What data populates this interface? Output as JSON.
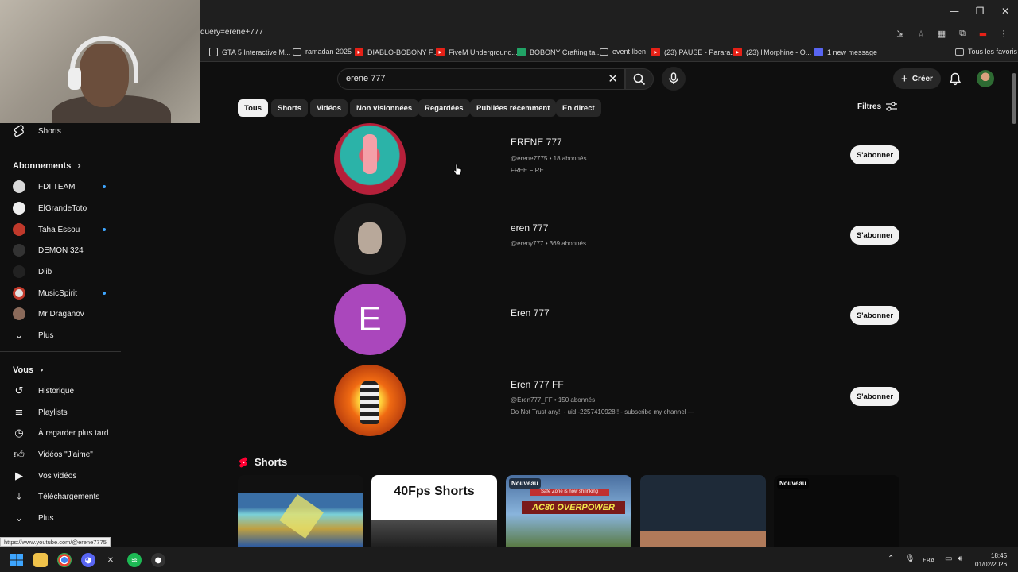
{
  "browser": {
    "url": "query=erene+777",
    "bookmarks": [
      {
        "label": "GTA 5 Interactive M...",
        "icon": "globe-icon"
      },
      {
        "label": "ramadan 2025",
        "icon": "folder-icon"
      },
      {
        "label": "DIABLO-BOBONY F...",
        "icon": "youtube-icon"
      },
      {
        "label": "FiveM Underground...",
        "icon": "youtube-icon"
      },
      {
        "label": "BOBONY Crafting ta...",
        "icon": "sheets-icon"
      },
      {
        "label": "event Iben",
        "icon": "folder-icon"
      },
      {
        "label": "(23) PAUSE - Parara...",
        "icon": "youtube-icon"
      },
      {
        "label": "(23) l'Morphine - O...",
        "icon": "youtube-icon"
      },
      {
        "label": "1 new message",
        "icon": "discord-icon"
      }
    ],
    "all_bookmarks": "Tous les favoris",
    "status_url": "https://www.youtube.com/@erene7775"
  },
  "search": {
    "query": "erene 777"
  },
  "masthead": {
    "create_label": "Créer"
  },
  "chips": [
    "Tous",
    "Shorts",
    "Vidéos",
    "Non visionnées",
    "Regardées",
    "Publiées récemment",
    "En direct"
  ],
  "filters_label": "Filtres",
  "sidebar": {
    "shorts_label": "Shorts",
    "subscriptions_header": "Abonnements",
    "subscriptions": [
      {
        "name": "FDI TEAM",
        "dot": true,
        "color": "#d8d8d8"
      },
      {
        "name": "ElGrandeToto",
        "dot": false,
        "color": "#eeeeee"
      },
      {
        "name": "Taha Essou",
        "dot": true,
        "color": "#c0392b"
      },
      {
        "name": "DEMON 324",
        "dot": false,
        "color": "#333333"
      },
      {
        "name": "Diib",
        "dot": false,
        "color": "#222222"
      },
      {
        "name": "MusicSpirit",
        "dot": true,
        "color": "#e0e0e0"
      },
      {
        "name": "Mr Draganov",
        "dot": false,
        "color": "#8a6a5a"
      }
    ],
    "more_label": "Plus",
    "you_header": "Vous",
    "you_items": [
      {
        "label": "Historique",
        "icon": "history-icon"
      },
      {
        "label": "Playlists",
        "icon": "playlists-icon"
      },
      {
        "label": "À regarder plus tard",
        "icon": "watch-later-icon"
      },
      {
        "label": "Vidéos \"J'aime\"",
        "icon": "like-icon"
      },
      {
        "label": "Vos vidéos",
        "icon": "your-videos-icon"
      },
      {
        "label": "Téléchargements",
        "icon": "downloads-icon"
      },
      {
        "label": "Plus",
        "icon": "chevron-down-icon"
      }
    ]
  },
  "channels": [
    {
      "title": "ERENE 777",
      "meta": "@erene7775 • 18 abonnés",
      "desc": "FREE FIRE.",
      "button": "S'abonner"
    },
    {
      "title": "eren 777",
      "meta": "@ereny777 • 369 abonnés",
      "desc": "",
      "button": "S'abonner"
    },
    {
      "title": "Eren 777",
      "meta": "",
      "desc": "",
      "button": "S'abonner",
      "initial": "E"
    },
    {
      "title": "Eren 777 FF",
      "meta": "@Eren777_FF • 150 abonnés",
      "desc": "Do Not Trust any!! - uid:-2257410928!! - subscribe my channel —",
      "button": "S'abonner"
    }
  ],
  "shorts_section": {
    "title": "Shorts",
    "items": [
      {
        "badge": "",
        "caption": ""
      },
      {
        "badge": "",
        "caption": "40Fps Shorts"
      },
      {
        "badge": "Nouveau",
        "caption": "AC80 OVERPOWER",
        "banner": "Safe Zone is now shrinking"
      },
      {
        "badge": "",
        "caption": ""
      },
      {
        "badge": "Nouveau",
        "caption": ""
      }
    ]
  },
  "taskbar": {
    "lang": "FRA",
    "time": "18:45",
    "date": "01/02/2026"
  },
  "colors": {
    "background": "#0f0f0f",
    "accent_blue": "#3ea6ff",
    "youtube_red": "#ff0033"
  }
}
